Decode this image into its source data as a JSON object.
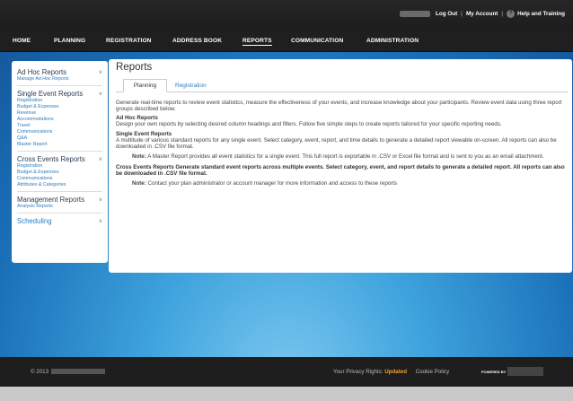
{
  "utility": {
    "logout": "Log Out",
    "my_account": "My Account",
    "help": "Help and Training"
  },
  "nav": {
    "items": [
      "HOME",
      "PLANNING",
      "REGISTRATION",
      "ADDRESS BOOK",
      "REPORTS",
      "COMMUNICATION",
      "ADMINISTRATION"
    ],
    "active": "REPORTS"
  },
  "sidebar": {
    "sections": [
      {
        "title": "Ad Hoc Reports",
        "items": [
          "Manage Ad Hoc Reports"
        ]
      },
      {
        "title": "Single Event Reports",
        "items": [
          "Registration",
          "Budget & Expenses",
          "Revenue",
          "Accommodations",
          "Travel",
          "Communications",
          "Q&A",
          "Master Report"
        ]
      },
      {
        "title": "Cross Events Reports",
        "items": [
          "Registration",
          "Budget & Expenses",
          "Communications",
          "Attributes & Categories"
        ]
      },
      {
        "title": "Management Reports",
        "items": [
          "Analysis Reports"
        ]
      },
      {
        "title": "Scheduling",
        "items": []
      }
    ]
  },
  "main": {
    "title": "Reports",
    "tabs": [
      "Planning",
      "Registration"
    ],
    "active_tab": "Planning",
    "intro": "Generate real-time reports to review event statistics, measure the effectiveness of your events, and increase knowledge about your participants. Review event data using three report groups described below.",
    "adhoc_title": "Ad Hoc Reports",
    "adhoc_text": "Design your own reports by selecting desired column headings and filters. Follow five simple steps to create reports tailored for your specific reporting needs.",
    "single_title": "Single Event Reports",
    "single_text": "A multitude of various standard reports for any single event. Select category, event, report, and time details to generate a detailed report viewable on-screen. All reports can also be downloaded in .CSV file format.",
    "note1_label": "Note:",
    "note1_text": "A Master Report provides all event statistics for a single event. This full report is exportable in .CSV or Excel file format and is sent to you as an email attachment.",
    "cross_text": "Cross Events Reports Generate standard event reports across multiple events. Select category, event, and report details to generate a detailed report. All reports can also be downloaded in .CSV file format.",
    "note2_label": "Note:",
    "note2_text": "Contact your plan administrator or account manager for more information and access to these reports"
  },
  "footer": {
    "copyright": "© 2013",
    "privacy": "Your Privacy Rights:",
    "updated": "Updated",
    "cookie": "Cookie Policy",
    "powered": "POWERED BY"
  },
  "colors": {
    "link": "#2c7cbf",
    "updated": "#f0a12d",
    "stage": "#1a6fb7"
  }
}
